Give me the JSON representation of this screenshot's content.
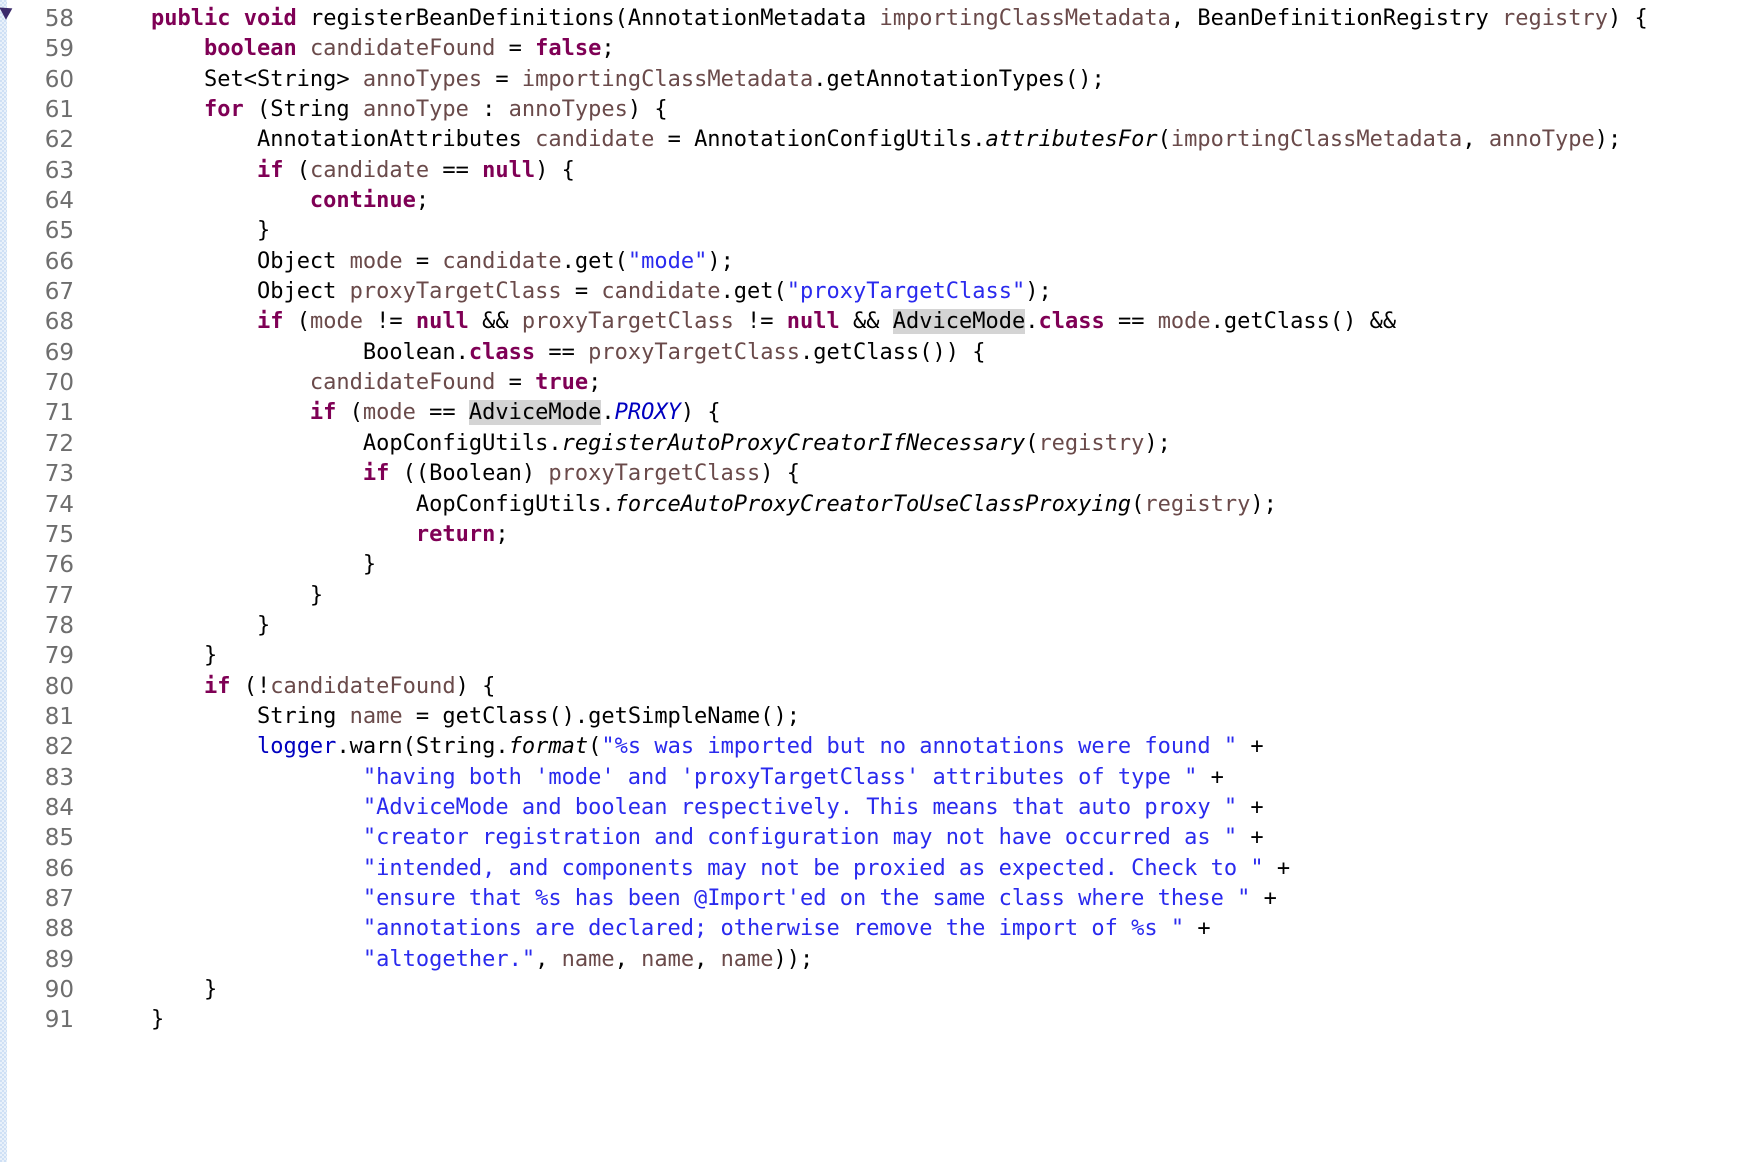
{
  "editor": {
    "language": "java",
    "first_line_number": 58,
    "last_line_number": 91,
    "indent_size": 4,
    "colors": {
      "background": "#ffffff",
      "gutter_text": "#6e6e6e",
      "keyword": "#7f0055",
      "plain": "#000000",
      "local_variable": "#6a4a4a",
      "field": "#0000c0",
      "string": "#2a2aee",
      "static_method": "#000000",
      "static_field": "#0000c0",
      "occurrence_highlight": "#d4d4d4",
      "change_strip": "#cfe0f5",
      "fold_marker": "#3b2a6b"
    },
    "markers": {
      "fold_marker": "collapse-triangle-icon",
      "change_strip": "vertical-change-bar"
    }
  },
  "lines": [
    {
      "number": "58",
      "indent": 1,
      "tokens": [
        {
          "t": "public",
          "c": "kw"
        },
        {
          "t": " ",
          "c": "plain"
        },
        {
          "t": "void",
          "c": "kw"
        },
        {
          "t": " ",
          "c": "plain"
        },
        {
          "t": "registerBeanDefinitions(AnnotationMetadata ",
          "c": "plain"
        },
        {
          "t": "importingClassMetadata",
          "c": "var"
        },
        {
          "t": ", BeanDefinitionRegistry ",
          "c": "plain"
        },
        {
          "t": "registry",
          "c": "var"
        },
        {
          "t": ") {",
          "c": "plain"
        }
      ]
    },
    {
      "number": "59",
      "indent": 2,
      "tokens": [
        {
          "t": "boolean",
          "c": "kw"
        },
        {
          "t": " ",
          "c": "plain"
        },
        {
          "t": "candidateFound",
          "c": "var"
        },
        {
          "t": " = ",
          "c": "plain"
        },
        {
          "t": "false",
          "c": "kw"
        },
        {
          "t": ";",
          "c": "plain"
        }
      ]
    },
    {
      "number": "60",
      "indent": 2,
      "tokens": [
        {
          "t": "Set<String> ",
          "c": "plain"
        },
        {
          "t": "annoTypes",
          "c": "var"
        },
        {
          "t": " = ",
          "c": "plain"
        },
        {
          "t": "importingClassMetadata",
          "c": "var"
        },
        {
          "t": ".getAnnotationTypes();",
          "c": "plain"
        }
      ]
    },
    {
      "number": "61",
      "indent": 2,
      "tokens": [
        {
          "t": "for",
          "c": "kw"
        },
        {
          "t": " (String ",
          "c": "plain"
        },
        {
          "t": "annoType",
          "c": "var"
        },
        {
          "t": " : ",
          "c": "plain"
        },
        {
          "t": "annoTypes",
          "c": "var"
        },
        {
          "t": ") {",
          "c": "plain"
        }
      ]
    },
    {
      "number": "62",
      "indent": 3,
      "tokens": [
        {
          "t": "AnnotationAttributes ",
          "c": "plain"
        },
        {
          "t": "candidate",
          "c": "var"
        },
        {
          "t": " = AnnotationConfigUtils.",
          "c": "plain"
        },
        {
          "t": "attributesFor",
          "c": "mtd"
        },
        {
          "t": "(",
          "c": "plain"
        },
        {
          "t": "importingClassMetadata",
          "c": "var"
        },
        {
          "t": ", ",
          "c": "plain"
        },
        {
          "t": "annoType",
          "c": "var"
        },
        {
          "t": ");",
          "c": "plain"
        }
      ]
    },
    {
      "number": "63",
      "indent": 3,
      "tokens": [
        {
          "t": "if",
          "c": "kw"
        },
        {
          "t": " (",
          "c": "plain"
        },
        {
          "t": "candidate",
          "c": "var"
        },
        {
          "t": " == ",
          "c": "plain"
        },
        {
          "t": "null",
          "c": "kw"
        },
        {
          "t": ") {",
          "c": "plain"
        }
      ]
    },
    {
      "number": "64",
      "indent": 4,
      "tokens": [
        {
          "t": "continue",
          "c": "kw"
        },
        {
          "t": ";",
          "c": "plain"
        }
      ]
    },
    {
      "number": "65",
      "indent": 3,
      "tokens": [
        {
          "t": "}",
          "c": "plain"
        }
      ]
    },
    {
      "number": "66",
      "indent": 3,
      "tokens": [
        {
          "t": "Object ",
          "c": "plain"
        },
        {
          "t": "mode",
          "c": "var"
        },
        {
          "t": " = ",
          "c": "plain"
        },
        {
          "t": "candidate",
          "c": "var"
        },
        {
          "t": ".get(",
          "c": "plain"
        },
        {
          "t": "\"mode\"",
          "c": "str"
        },
        {
          "t": ");",
          "c": "plain"
        }
      ]
    },
    {
      "number": "67",
      "indent": 3,
      "tokens": [
        {
          "t": "Object ",
          "c": "plain"
        },
        {
          "t": "proxyTargetClass",
          "c": "var"
        },
        {
          "t": " = ",
          "c": "plain"
        },
        {
          "t": "candidate",
          "c": "var"
        },
        {
          "t": ".get(",
          "c": "plain"
        },
        {
          "t": "\"proxyTargetClass\"",
          "c": "str"
        },
        {
          "t": ");",
          "c": "plain"
        }
      ]
    },
    {
      "number": "68",
      "indent": 3,
      "tokens": [
        {
          "t": "if",
          "c": "kw"
        },
        {
          "t": " (",
          "c": "plain"
        },
        {
          "t": "mode",
          "c": "var"
        },
        {
          "t": " != ",
          "c": "plain"
        },
        {
          "t": "null",
          "c": "kw"
        },
        {
          "t": " && ",
          "c": "plain"
        },
        {
          "t": "proxyTargetClass",
          "c": "var"
        },
        {
          "t": " != ",
          "c": "plain"
        },
        {
          "t": "null",
          "c": "kw"
        },
        {
          "t": " && ",
          "c": "plain"
        },
        {
          "t": "AdviceMode",
          "c": "plain hl"
        },
        {
          "t": ".",
          "c": "plain"
        },
        {
          "t": "class",
          "c": "kw"
        },
        {
          "t": " == ",
          "c": "plain"
        },
        {
          "t": "mode",
          "c": "var"
        },
        {
          "t": ".getClass() &&",
          "c": "plain"
        }
      ]
    },
    {
      "number": "69",
      "indent": 5,
      "tokens": [
        {
          "t": "Boolean.",
          "c": "plain"
        },
        {
          "t": "class",
          "c": "kw"
        },
        {
          "t": " == ",
          "c": "plain"
        },
        {
          "t": "proxyTargetClass",
          "c": "var"
        },
        {
          "t": ".getClass()) {",
          "c": "plain"
        }
      ]
    },
    {
      "number": "70",
      "indent": 4,
      "tokens": [
        {
          "t": "candidateFound",
          "c": "var"
        },
        {
          "t": " = ",
          "c": "plain"
        },
        {
          "t": "true",
          "c": "kw"
        },
        {
          "t": ";",
          "c": "plain"
        }
      ]
    },
    {
      "number": "71",
      "indent": 4,
      "tokens": [
        {
          "t": "if",
          "c": "kw"
        },
        {
          "t": " (",
          "c": "plain"
        },
        {
          "t": "mode",
          "c": "var"
        },
        {
          "t": " == ",
          "c": "plain"
        },
        {
          "t": "AdviceMode",
          "c": "plain hl"
        },
        {
          "t": ".",
          "c": "plain"
        },
        {
          "t": "PROXY",
          "c": "sfld"
        },
        {
          "t": ") {",
          "c": "plain"
        }
      ]
    },
    {
      "number": "72",
      "indent": 5,
      "tokens": [
        {
          "t": "AopConfigUtils.",
          "c": "plain"
        },
        {
          "t": "registerAutoProxyCreatorIfNecessary",
          "c": "mtd"
        },
        {
          "t": "(",
          "c": "plain"
        },
        {
          "t": "registry",
          "c": "var"
        },
        {
          "t": ");",
          "c": "plain"
        }
      ]
    },
    {
      "number": "73",
      "indent": 5,
      "tokens": [
        {
          "t": "if",
          "c": "kw"
        },
        {
          "t": " ((Boolean) ",
          "c": "plain"
        },
        {
          "t": "proxyTargetClass",
          "c": "var"
        },
        {
          "t": ") {",
          "c": "plain"
        }
      ]
    },
    {
      "number": "74",
      "indent": 6,
      "tokens": [
        {
          "t": "AopConfigUtils.",
          "c": "plain"
        },
        {
          "t": "forceAutoProxyCreatorToUseClassProxying",
          "c": "mtd"
        },
        {
          "t": "(",
          "c": "plain"
        },
        {
          "t": "registry",
          "c": "var"
        },
        {
          "t": ");",
          "c": "plain"
        }
      ]
    },
    {
      "number": "75",
      "indent": 6,
      "tokens": [
        {
          "t": "return",
          "c": "kw"
        },
        {
          "t": ";",
          "c": "plain"
        }
      ]
    },
    {
      "number": "76",
      "indent": 5,
      "tokens": [
        {
          "t": "}",
          "c": "plain"
        }
      ]
    },
    {
      "number": "77",
      "indent": 4,
      "tokens": [
        {
          "t": "}",
          "c": "plain"
        }
      ]
    },
    {
      "number": "78",
      "indent": 3,
      "tokens": [
        {
          "t": "}",
          "c": "plain"
        }
      ]
    },
    {
      "number": "79",
      "indent": 2,
      "tokens": [
        {
          "t": "}",
          "c": "plain"
        }
      ]
    },
    {
      "number": "80",
      "indent": 2,
      "tokens": [
        {
          "t": "if",
          "c": "kw"
        },
        {
          "t": " (!",
          "c": "plain"
        },
        {
          "t": "candidateFound",
          "c": "var"
        },
        {
          "t": ") {",
          "c": "plain"
        }
      ]
    },
    {
      "number": "81",
      "indent": 3,
      "tokens": [
        {
          "t": "String ",
          "c": "plain"
        },
        {
          "t": "name",
          "c": "var"
        },
        {
          "t": " = getClass().getSimpleName();",
          "c": "plain"
        }
      ]
    },
    {
      "number": "82",
      "indent": 3,
      "tokens": [
        {
          "t": "logger",
          "c": "fld"
        },
        {
          "t": ".warn(String.",
          "c": "plain"
        },
        {
          "t": "format",
          "c": "mtd"
        },
        {
          "t": "(",
          "c": "plain"
        },
        {
          "t": "\"%s was imported but no annotations were found \"",
          "c": "str"
        },
        {
          "t": " +",
          "c": "plain"
        }
      ]
    },
    {
      "number": "83",
      "indent": 5,
      "tokens": [
        {
          "t": "\"having both 'mode' and 'proxyTargetClass' attributes of type \"",
          "c": "str"
        },
        {
          "t": " +",
          "c": "plain"
        }
      ]
    },
    {
      "number": "84",
      "indent": 5,
      "tokens": [
        {
          "t": "\"AdviceMode and boolean respectively. This means that auto proxy \"",
          "c": "str"
        },
        {
          "t": " +",
          "c": "plain"
        }
      ]
    },
    {
      "number": "85",
      "indent": 5,
      "tokens": [
        {
          "t": "\"creator registration and configuration may not have occurred as \"",
          "c": "str"
        },
        {
          "t": " +",
          "c": "plain"
        }
      ]
    },
    {
      "number": "86",
      "indent": 5,
      "tokens": [
        {
          "t": "\"intended, and components may not be proxied as expected. Check to \"",
          "c": "str"
        },
        {
          "t": " +",
          "c": "plain"
        }
      ]
    },
    {
      "number": "87",
      "indent": 5,
      "tokens": [
        {
          "t": "\"ensure that %s has been @Import'ed on the same class where these \"",
          "c": "str"
        },
        {
          "t": " +",
          "c": "plain"
        }
      ]
    },
    {
      "number": "88",
      "indent": 5,
      "tokens": [
        {
          "t": "\"annotations are declared; otherwise remove the import of %s \"",
          "c": "str"
        },
        {
          "t": " +",
          "c": "plain"
        }
      ]
    },
    {
      "number": "89",
      "indent": 5,
      "tokens": [
        {
          "t": "\"altogether.\"",
          "c": "str"
        },
        {
          "t": ", ",
          "c": "plain"
        },
        {
          "t": "name",
          "c": "var"
        },
        {
          "t": ", ",
          "c": "plain"
        },
        {
          "t": "name",
          "c": "var"
        },
        {
          "t": ", ",
          "c": "plain"
        },
        {
          "t": "name",
          "c": "var"
        },
        {
          "t": "));",
          "c": "plain"
        }
      ]
    },
    {
      "number": "90",
      "indent": 2,
      "tokens": [
        {
          "t": "}",
          "c": "plain"
        }
      ]
    },
    {
      "number": "91",
      "indent": 1,
      "tokens": [
        {
          "t": "}",
          "c": "plain"
        }
      ]
    }
  ]
}
